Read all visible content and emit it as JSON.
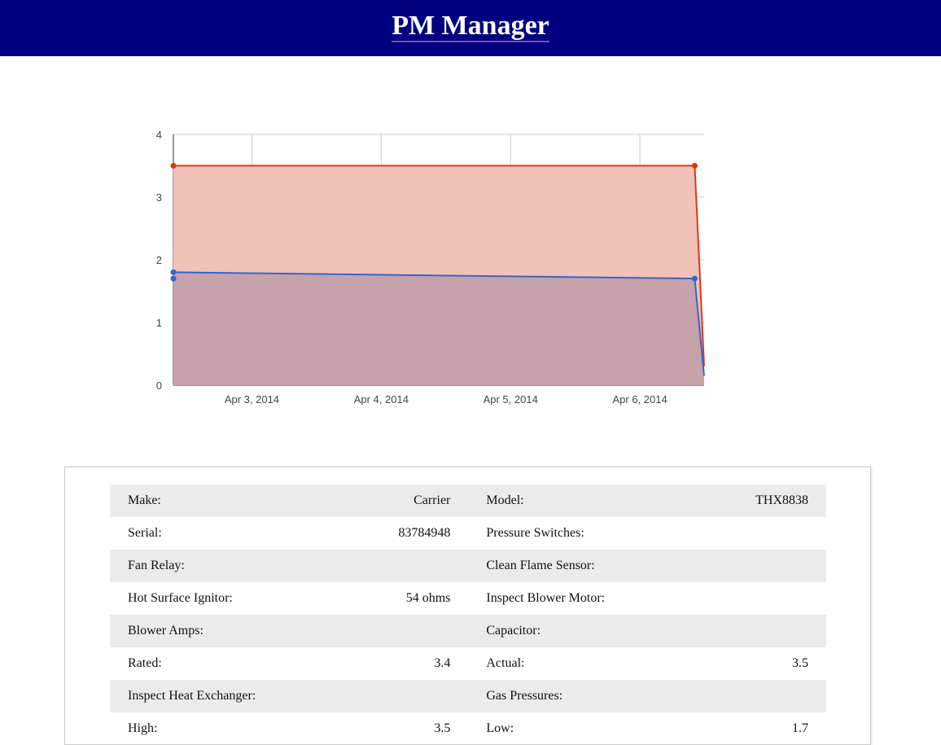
{
  "header": {
    "title": "PM Manager"
  },
  "chart_data": {
    "type": "area",
    "x": [
      "2014-04-02T09:26",
      "2014-04-06T10:10",
      "2014-04-06T11:55"
    ],
    "x_tick_labels": [
      "Apr 3, 2014",
      "Apr 4, 2014",
      "Apr 5, 2014",
      "Apr 6, 2014"
    ],
    "x_ticks": [
      "2014-04-03",
      "2014-04-04",
      "2014-04-05",
      "2014-04-06"
    ],
    "series": [
      {
        "color": "#dc3912",
        "fill": "#f2c2b8",
        "values": [
          3.5,
          3.5,
          0.3
        ]
      },
      {
        "color": "#3366cc",
        "fill": "#c7a2ab",
        "values": [
          1.8,
          1.7,
          0.15
        ]
      }
    ],
    "extra_points": [
      {
        "series": 1,
        "x": "2014-04-02T09:26",
        "y": 1.7
      }
    ],
    "y_ticks": [
      0,
      1,
      2,
      3,
      4
    ],
    "ylim": [
      0,
      4
    ],
    "xlim": [
      "2014-04-02T09:26",
      "2014-04-06T11:55"
    ],
    "grid": true
  },
  "details": {
    "rows": [
      [
        "Make:",
        "Carrier",
        "Model:",
        "THX8838"
      ],
      [
        "Serial:",
        "83784948",
        "Pressure Switches:",
        ""
      ],
      [
        "Fan Relay:",
        "",
        "Clean Flame Sensor:",
        ""
      ],
      [
        "Hot Surface Ignitor:",
        "54 ohms",
        "Inspect Blower Motor:",
        ""
      ],
      [
        "Blower Amps:",
        "",
        "Capacitor:",
        ""
      ],
      [
        "Rated:",
        "3.4",
        "Actual:",
        "3.5"
      ],
      [
        "Inspect Heat Exchanger:",
        "",
        "Gas Pressures:",
        ""
      ],
      [
        "High:",
        "3.5",
        "Low:",
        "1.7"
      ]
    ]
  }
}
